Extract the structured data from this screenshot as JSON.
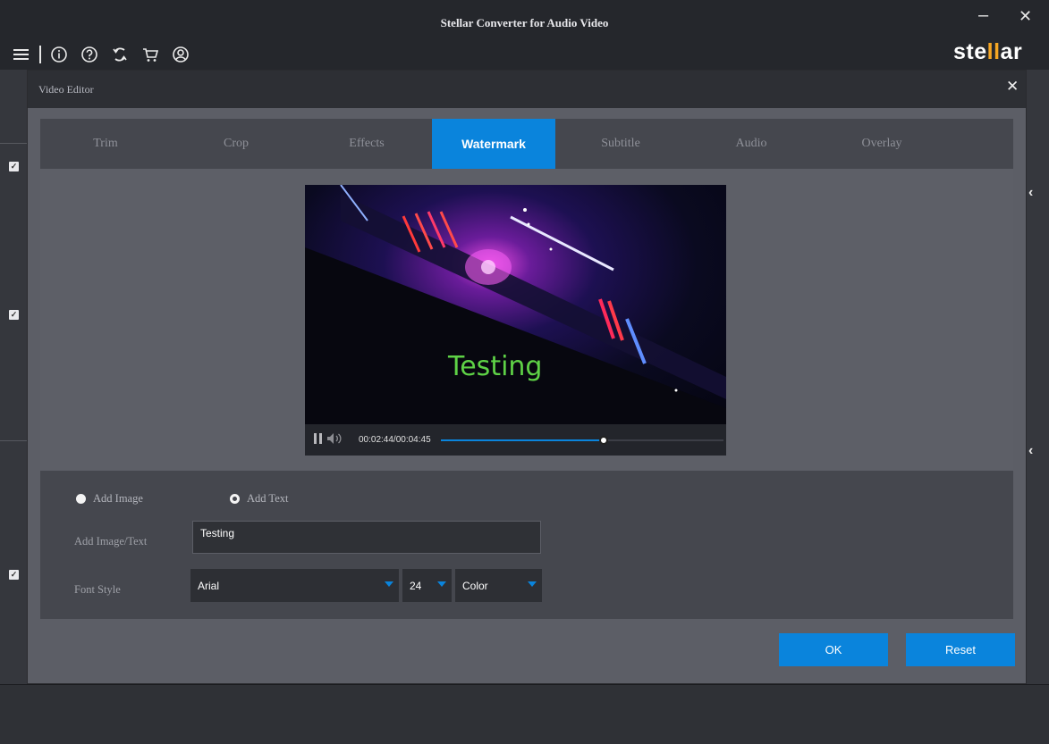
{
  "app": {
    "title": "Stellar Converter for Audio Video",
    "brand_prefix": "ste",
    "brand_mark": "ll",
    "brand_suffix": "ar",
    "minimize_glyph": "–",
    "close_glyph": "✕",
    "toolbar_icons": [
      "menu-icon",
      "info-icon",
      "help-icon",
      "refresh-icon",
      "cart-icon",
      "account-icon"
    ]
  },
  "background": {
    "checkbox_glyph": "✓",
    "chevron_glyph": "‹"
  },
  "dialog": {
    "title": "Video Editor",
    "close_glyph": "✕",
    "tabs": [
      {
        "label": "Trim"
      },
      {
        "label": "Crop"
      },
      {
        "label": "Effects"
      },
      {
        "label": "Watermark"
      },
      {
        "label": "Subtitle"
      },
      {
        "label": "Audio"
      },
      {
        "label": "Overlay"
      }
    ],
    "active_tab": "Watermark",
    "player": {
      "watermark_text": "Testing",
      "time": "00:02:44/00:04:45",
      "progress": 0.5747
    },
    "form": {
      "add_image_label": "Add Image",
      "add_text_label": "Add Text",
      "image_text_label": "Add Image/Text",
      "text_value": "Testing",
      "font_style_label": "Font Style",
      "font_family_value": "Arial",
      "font_size_value": "24",
      "color_value": "Color"
    },
    "buttons": {
      "ok": "OK",
      "reset": "Reset"
    }
  },
  "colors": {
    "accent": "#0a84dc",
    "watermark": "#5ed146",
    "brand_highlight": "#f5a623"
  }
}
